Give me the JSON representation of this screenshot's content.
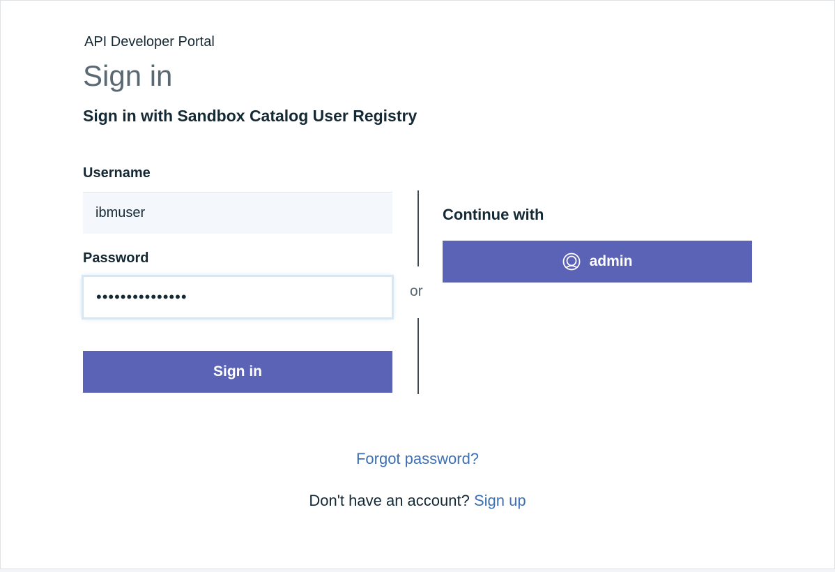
{
  "header": {
    "portal_title": "API Developer Portal",
    "page_title": "Sign in",
    "registry_heading": "Sign in with Sandbox Catalog User Registry"
  },
  "form": {
    "username_label": "Username",
    "username_value": "ibmuser",
    "password_label": "Password",
    "password_value": "•••••••••••••••",
    "signin_label": "Sign in"
  },
  "divider": {
    "or_text": "or"
  },
  "alternatives": {
    "continue_heading": "Continue with",
    "provider_label": "admin",
    "provider_icon": "user-circle-icon"
  },
  "footer": {
    "forgot_password": "Forgot password?",
    "no_account_text": "Don't have an account?",
    "signup_link": "Sign up"
  },
  "colors": {
    "primary_button": "#5b63b7",
    "link": "#3d70b2",
    "text": "#152935",
    "muted_text": "#5a6872",
    "username_field_bg": "#f4f7fb"
  }
}
